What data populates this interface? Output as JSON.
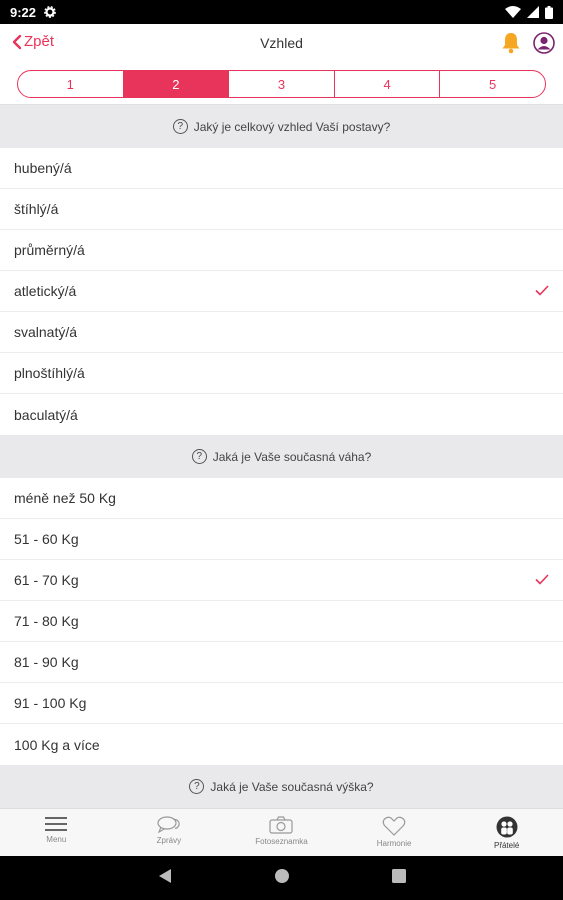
{
  "status_bar": {
    "time": "9:22"
  },
  "header": {
    "back_label": "Zpět",
    "title": "Vzhled"
  },
  "steps": [
    "1",
    "2",
    "3",
    "4",
    "5"
  ],
  "active_step": 2,
  "sections": [
    {
      "question": "Jaký je celkový vzhled Vaší postavy?",
      "options": [
        "hubený/á",
        "štíhlý/á",
        "průměrný/á",
        "atletický/á",
        "svalnatý/á",
        "plnoštíhlý/á",
        "baculatý/á"
      ],
      "selected": "atletický/á"
    },
    {
      "question": "Jaká je Vaše současná váha?",
      "options": [
        "méně než 50 Kg",
        "51 - 60 Kg",
        "61 - 70 Kg",
        "71 - 80 Kg",
        "81 - 90 Kg",
        "91 - 100 Kg",
        "100 Kg a více"
      ],
      "selected": "61 - 70 Kg"
    },
    {
      "question": "Jaká je Vaše současná výška?",
      "options": [],
      "selected": ""
    }
  ],
  "tabbar": {
    "items": [
      {
        "label": "Menu",
        "icon": "menu-icon"
      },
      {
        "label": "Zprávy",
        "icon": "messages-icon"
      },
      {
        "label": "Fotoseznamka",
        "icon": "camera-icon"
      },
      {
        "label": "Harmonie",
        "icon": "heart-icon"
      },
      {
        "label": "Přátelé",
        "icon": "friends-icon"
      }
    ],
    "active_index": 4
  },
  "colors": {
    "accent": "#e8345a",
    "notification": "#f5a623",
    "section_bg": "#e9e9ec"
  }
}
